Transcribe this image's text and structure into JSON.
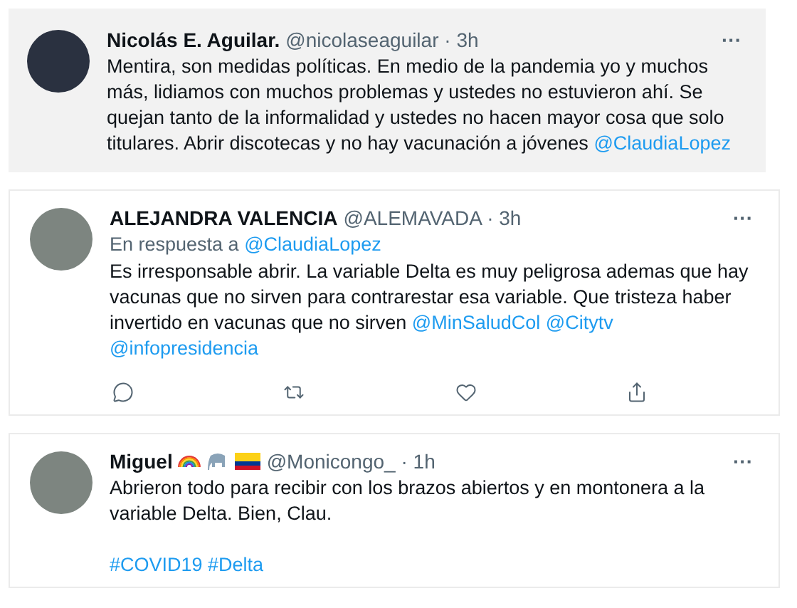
{
  "tweets": [
    {
      "highlighted": true,
      "name": "Nicolás E. Aguilar.",
      "handle": "@nicolaseaguilar",
      "sep": "·",
      "time": "3h",
      "more": "···",
      "paragraphs": [
        [
          {
            "kind": "text",
            "text": "Mentira, son medidas políticas. En medio de la pandemia yo y muchos más, lidiamos con muchos problemas y ustedes no estuvieron ahí. Se quejan tanto de la informalidad y ustedes no hacen mayor cosa que solo titulares. Abrir discotecas y no hay vacunación a jóvenes"
          },
          {
            "kind": "link",
            "text": "@ClaudiaLopez"
          }
        ]
      ]
    },
    {
      "highlighted": false,
      "name": "ALEJANDRA VALENCIA",
      "handle": "@ALEMAVADA",
      "sep": "·",
      "time": "3h",
      "more": "···",
      "reply_to": {
        "prefix": "En respuesta a",
        "link": "@ClaudiaLopez"
      },
      "paragraphs": [
        [
          {
            "kind": "text",
            "text": "Es irresponsable abrir. La variable Delta es muy peligrosa ademas que hay vacunas que no sirven para contrarestar esa variable. Que tristeza haber invertido en vacunas que no sirven"
          },
          {
            "kind": "link",
            "text": "@MinSaludCol"
          },
          {
            "kind": "link",
            "text": "@Citytv"
          },
          {
            "kind": "link",
            "text": "@infopresidencia"
          }
        ]
      ],
      "actions": [
        {
          "kind": "reply"
        },
        {
          "kind": "retweet"
        },
        {
          "kind": "like"
        },
        {
          "kind": "share"
        }
      ]
    },
    {
      "highlighted": false,
      "name": "Miguel",
      "badges": [
        {
          "kind": "rainbow"
        },
        {
          "kind": "elephant"
        },
        {
          "kind": "flag"
        }
      ],
      "handle": "@Monicongo_",
      "sep": "·",
      "time": "1h",
      "more": "···",
      "paragraphs": [
        [
          {
            "kind": "text",
            "text": "Abrieron todo para recibir con los brazos abiertos y en montonera a la variable Delta. Bien, Clau."
          }
        ],
        [
          {
            "kind": "link",
            "text": "#COVID19"
          },
          {
            "kind": "link",
            "text": "#Delta"
          }
        ]
      ]
    }
  ]
}
